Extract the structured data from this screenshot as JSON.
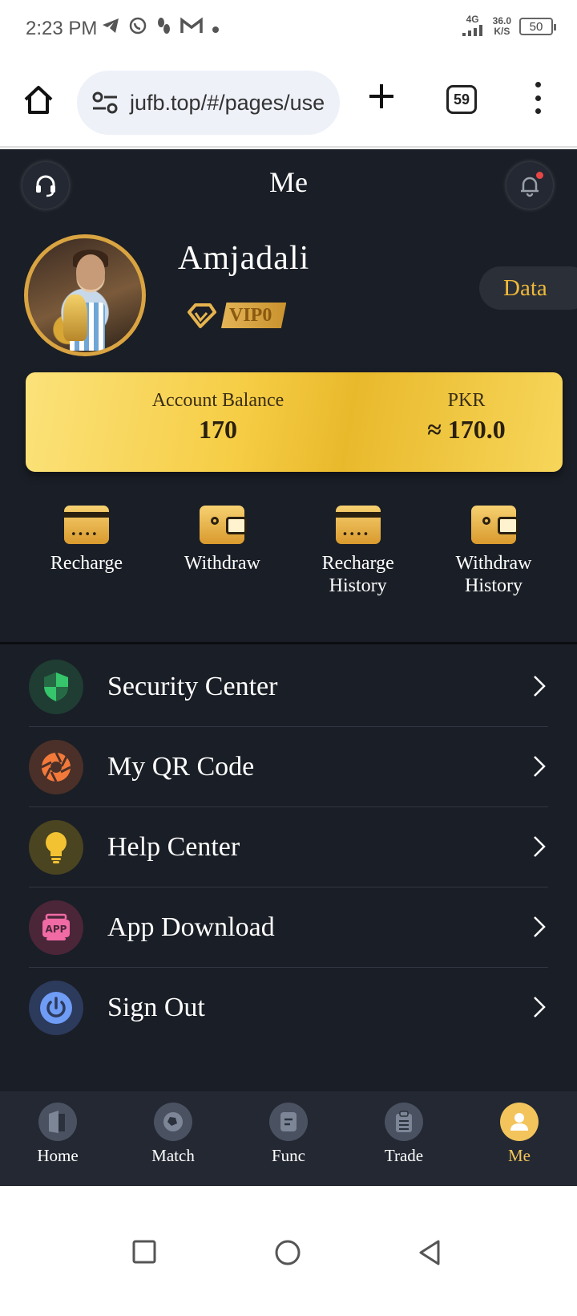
{
  "status_bar": {
    "time": "2:23 PM",
    "network": "4G",
    "speed_value": "36.0",
    "speed_unit": "K/S",
    "battery": "50"
  },
  "browser": {
    "url": "jufb.top/#/pages/use",
    "tab_count": "59"
  },
  "header": {
    "title": "Me"
  },
  "profile": {
    "username": "Amjadali",
    "vip_level": "VIP0",
    "data_button": "Data"
  },
  "balance": {
    "account_label": "Account Balance",
    "account_value": "170",
    "currency_label": "PKR",
    "currency_value": "≈ 170.0"
  },
  "actions": [
    {
      "label": "Recharge",
      "icon": "card-icon"
    },
    {
      "label": "Withdraw",
      "icon": "wallet-icon"
    },
    {
      "label": "Recharge History",
      "icon": "card-icon"
    },
    {
      "label": "Withdraw History",
      "icon": "wallet-icon"
    }
  ],
  "menu": [
    {
      "label": "Security Center",
      "icon": "shield-icon",
      "icon_bg": "#1f3d33",
      "icon_color": "#36c56a"
    },
    {
      "label": "My QR Code",
      "icon": "aperture-icon",
      "icon_bg": "#4a3028",
      "icon_color": "#f2793a"
    },
    {
      "label": "Help Center",
      "icon": "lightbulb-icon",
      "icon_bg": "#4a4420",
      "icon_color": "#f2c233"
    },
    {
      "label": "App Download",
      "icon": "app-icon",
      "icon_bg": "#4a2638",
      "icon_color": "#f06aa4"
    },
    {
      "label": "Sign Out",
      "icon": "power-icon",
      "icon_bg": "#2c3a5c",
      "icon_color": "#6f9cf5"
    }
  ],
  "bottom_nav": [
    {
      "label": "Home",
      "icon": "home-icon",
      "active": false
    },
    {
      "label": "Match",
      "icon": "ball-icon",
      "active": false
    },
    {
      "label": "Func",
      "icon": "document-icon",
      "active": false
    },
    {
      "label": "Trade",
      "icon": "clipboard-icon",
      "active": false
    },
    {
      "label": "Me",
      "icon": "user-icon",
      "active": true
    }
  ],
  "colors": {
    "app_bg": "#1a1e26",
    "accent_gold": "#f2c45b",
    "card_gold": "#f6cd45"
  }
}
